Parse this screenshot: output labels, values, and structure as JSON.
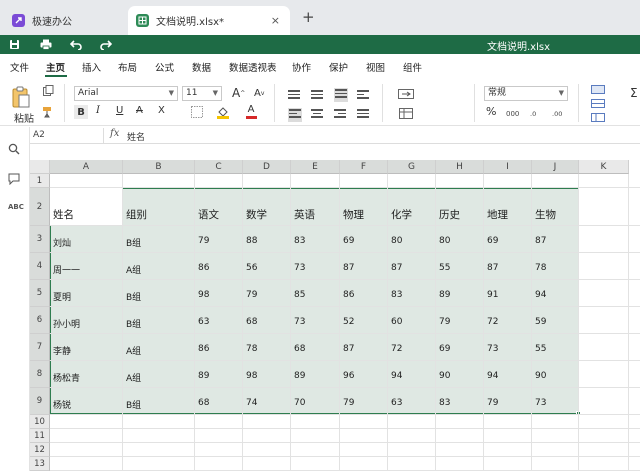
{
  "tabs": {
    "app_label": "极速办公",
    "doc_label": "文档说明.xlsx*",
    "close_symbol": "×",
    "new_tab_symbol": "+"
  },
  "titlebar": {
    "doc_title": "文档说明.xlsx",
    "save_icon": "save-icon",
    "print_icon": "print-icon",
    "undo_icon": "undo-icon",
    "redo_icon": "redo-icon",
    "bar_color": "#1e6b45"
  },
  "menu": [
    "文件",
    "主页",
    "插入",
    "布局",
    "公式",
    "数据",
    "数据透视表",
    "协作",
    "保护",
    "视图",
    "组件"
  ],
  "ribbon": {
    "paste_label": "粘贴",
    "font_name": "Arial",
    "font_size": "11",
    "number_format": "常规",
    "grow_font": "A",
    "shrink_font": "A",
    "bold": "B",
    "italic": "I",
    "underline": "U",
    "strikethrough": "A",
    "superscript": "X",
    "font_color": "A",
    "percent": "%",
    "sigma": "Σ"
  },
  "formula_bar": {
    "name_box": "A2",
    "fx_label": "fx",
    "formula": "姓名"
  },
  "sidebar_icons": [
    "search-icon",
    "comment-icon",
    "spellcheck-icon"
  ],
  "sheet": {
    "columns": [
      "A",
      "B",
      "C",
      "D",
      "E",
      "F",
      "G",
      "H",
      "I",
      "J",
      "K"
    ],
    "rows": [
      "1",
      "2",
      "3",
      "4",
      "5",
      "6",
      "7",
      "8",
      "9",
      "10",
      "11",
      "12",
      "13"
    ],
    "header_row": [
      "姓名",
      "组别",
      "语文",
      "数学",
      "英语",
      "物理",
      "化学",
      "历史",
      "地理",
      "生物"
    ],
    "data": [
      [
        "刘灿",
        "B组",
        "79",
        "88",
        "83",
        "69",
        "80",
        "80",
        "69",
        "87"
      ],
      [
        "周一一",
        "A组",
        "86",
        "56",
        "73",
        "87",
        "87",
        "55",
        "87",
        "78"
      ],
      [
        "夏明",
        "B组",
        "98",
        "79",
        "85",
        "86",
        "83",
        "89",
        "91",
        "94"
      ],
      [
        "孙小明",
        "B组",
        "63",
        "68",
        "73",
        "52",
        "60",
        "79",
        "72",
        "59"
      ],
      [
        "李静",
        "A组",
        "86",
        "78",
        "68",
        "87",
        "72",
        "69",
        "73",
        "55"
      ],
      [
        "杨松青",
        "A组",
        "89",
        "98",
        "89",
        "96",
        "94",
        "90",
        "94",
        "90"
      ],
      [
        "杨锐",
        "B组",
        "68",
        "74",
        "70",
        "79",
        "63",
        "83",
        "79",
        "73"
      ]
    ],
    "selection_color": "#2e7d4f"
  }
}
